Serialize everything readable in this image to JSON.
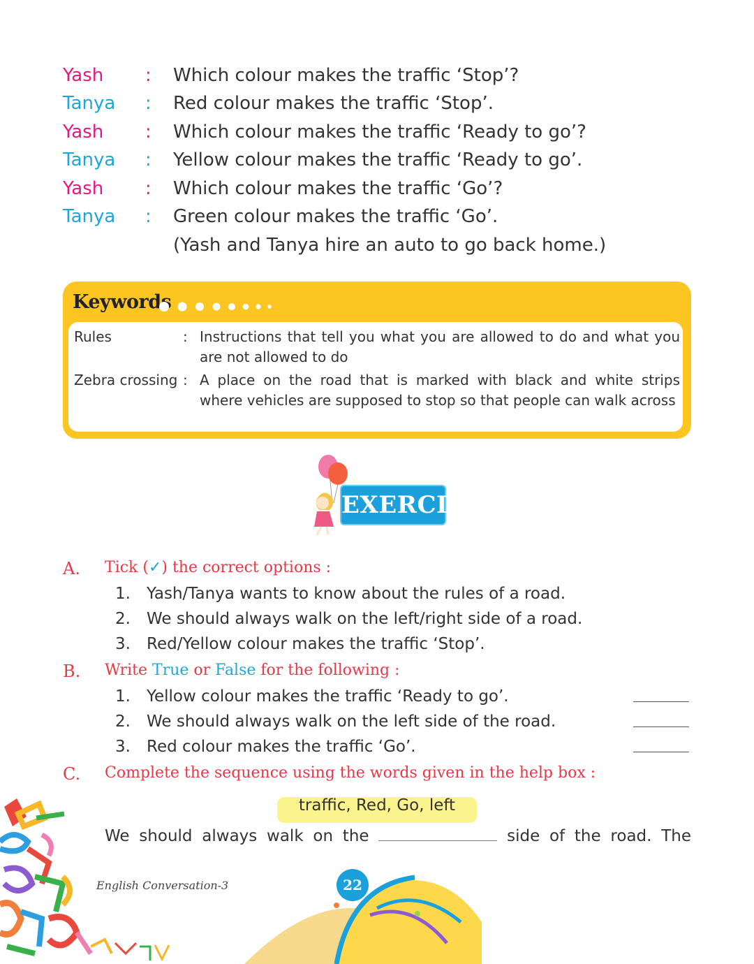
{
  "dialogue": [
    {
      "speaker": "Yash",
      "colon": ":",
      "text": "Which colour makes the traffic ‘Stop’?"
    },
    {
      "speaker": "Tanya",
      "colon": ":",
      "text": "Red colour makes the traffic ‘Stop’."
    },
    {
      "speaker": "Yash",
      "colon": ":",
      "text": "Which colour makes the traffic ‘Ready to go’?"
    },
    {
      "speaker": "Tanya",
      "colon": ":",
      "text": "Yellow colour makes the traffic ‘Ready to go’."
    },
    {
      "speaker": "Yash",
      "colon": ":",
      "text": "Which colour makes the traffic ‘Go’?"
    },
    {
      "speaker": "Tanya",
      "colon": ":",
      "text": "Green colour makes the traffic ‘Go’."
    }
  ],
  "dialogue_note": "(Yash and Tanya hire an auto to go back home.)",
  "keywords": {
    "title": "Keywords",
    "items": [
      {
        "term": "Rules",
        "colon": ":",
        "definition": "Instructions that tell you what you are allowed to do and what you are not allowed to do"
      },
      {
        "term": "Zebra crossing",
        "colon": ":",
        "definition": "A place on the road that is marked with black and white strips where vehicles are supposed to stop so that people can walk across"
      }
    ]
  },
  "exercise_label": "EXERCISE",
  "section_a": {
    "letter": "A.",
    "heading_pre": "Tick (",
    "tick": "✓",
    "heading_post": ") the correct options :",
    "questions": [
      {
        "num": "1.",
        "text": "Yash/Tanya wants to know about the rules of a road."
      },
      {
        "num": "2.",
        "text": "We should always walk on the left/right side of a road."
      },
      {
        "num": "3.",
        "text": "Red/Yellow colour makes the traffic ‘Stop’."
      }
    ]
  },
  "section_b": {
    "letter": "B.",
    "heading_1": "Write ",
    "heading_true": "True",
    "heading_2": " or ",
    "heading_false": "False",
    "heading_3": " for the following :",
    "questions": [
      {
        "num": "1.",
        "text": "Yellow colour makes the traffic ‘Ready to go’."
      },
      {
        "num": "2.",
        "text": "We should always walk on the left side of the road."
      },
      {
        "num": "3.",
        "text": "Red colour makes the traffic ‘Go’."
      }
    ]
  },
  "section_c": {
    "letter": "C.",
    "heading": "Complete the sequence using the words given in the help box :",
    "help_box": "traffic, Red, Go, left",
    "sentence_pre": "We should always walk on the ",
    "sentence_post": " side of the road. The"
  },
  "footer": {
    "book_title": "English Conversation-3",
    "page_number": "22"
  },
  "colors": {
    "yash": "#e6187f",
    "tanya": "#1ea7d6",
    "keywords_box": "#fcc521",
    "section_heading": "#e53946",
    "exercise_badge": "#1ba0db",
    "help_box": "#fbf38d"
  }
}
